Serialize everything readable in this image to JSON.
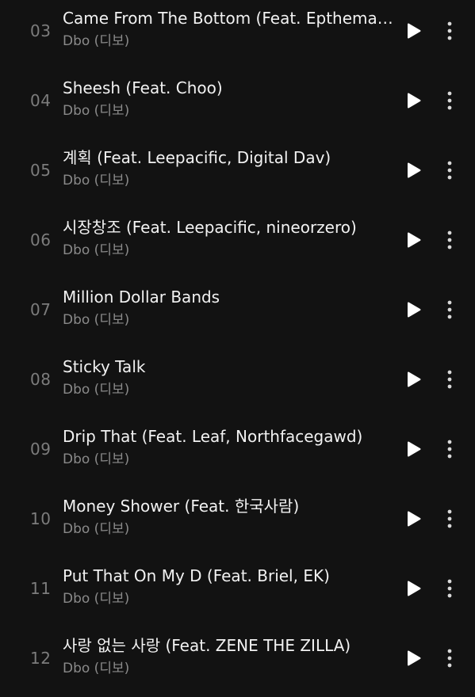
{
  "theme": {
    "background": "#121212",
    "title_color": "#f2f2f2",
    "secondary_color": "#8a8a8a",
    "number_color": "#7c7c7c",
    "icon_color": "#ffffff"
  },
  "tracks": [
    {
      "number": "03",
      "title": "Came From The Bottom (Feat. Epthemars...",
      "artist": "Dbo (디보)"
    },
    {
      "number": "04",
      "title": "Sheesh (Feat. Choo)",
      "artist": "Dbo (디보)"
    },
    {
      "number": "05",
      "title": "계획 (Feat. Leepacific, Digital Dav)",
      "artist": "Dbo (디보)"
    },
    {
      "number": "06",
      "title": "시장창조 (Feat. Leepacific, nineorzero)",
      "artist": "Dbo (디보)"
    },
    {
      "number": "07",
      "title": "Million Dollar Bands",
      "artist": "Dbo (디보)"
    },
    {
      "number": "08",
      "title": "Sticky Talk",
      "artist": "Dbo (디보)"
    },
    {
      "number": "09",
      "title": "Drip That (Feat. Leaf, Northfacegawd)",
      "artist": "Dbo (디보)"
    },
    {
      "number": "10",
      "title": "Money Shower (Feat. 한국사람)",
      "artist": "Dbo (디보)"
    },
    {
      "number": "11",
      "title": "Put That On My D (Feat. Briel, EK)",
      "artist": "Dbo (디보)"
    },
    {
      "number": "12",
      "title": "사랑 없는 사랑 (Feat. ZENE THE ZILLA)",
      "artist": "Dbo (디보)"
    }
  ],
  "icons": {
    "play": "play-icon",
    "more": "more-vertical-icon"
  }
}
